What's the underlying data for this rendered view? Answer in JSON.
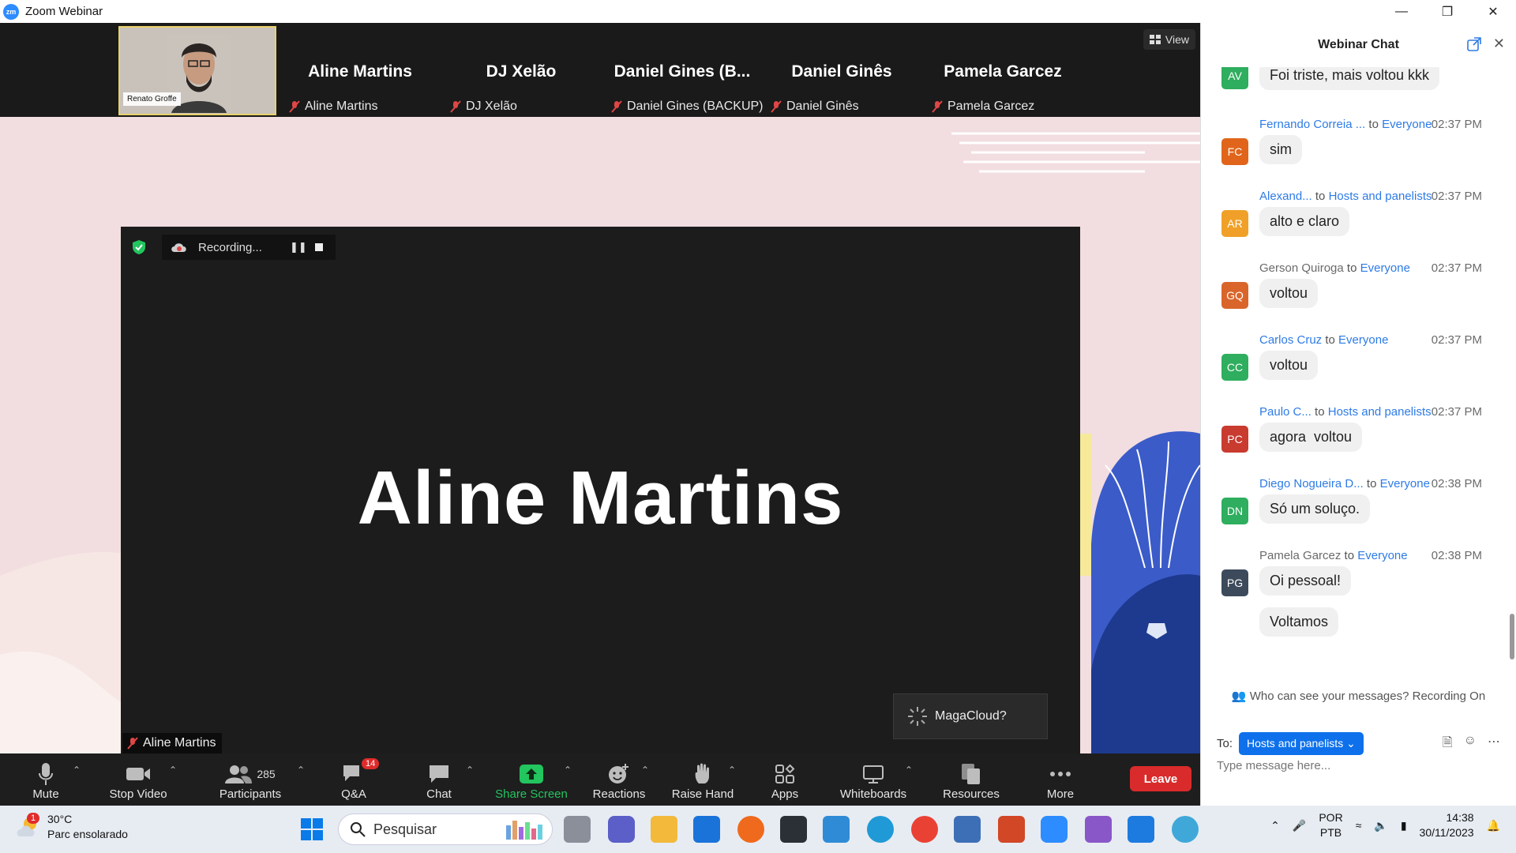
{
  "window": {
    "title": "Zoom Webinar",
    "app_icon": "zm"
  },
  "strip": {
    "self": {
      "name": "Renato Groffe"
    },
    "tiles": [
      {
        "big": "Aline Martins",
        "small": "Aline Martins"
      },
      {
        "big": "DJ Xelão",
        "small": "DJ Xelão"
      },
      {
        "big": "Daniel Gines (B...",
        "small": "Daniel Gines (BACKUP)"
      },
      {
        "big": "Daniel Ginês",
        "small": "Daniel Ginês"
      },
      {
        "big": "Pamela Garcez",
        "small": "Pamela Garcez"
      }
    ],
    "view_label": "View"
  },
  "stage": {
    "recording_label": "Recording...",
    "speaker_big": "Aline Martins",
    "speaker_label": "Aline Martins",
    "tooltip": "MagaCloud?"
  },
  "toolbar": {
    "mute": "Mute",
    "stop_video": "Stop Video",
    "participants": "Participants",
    "participants_count": "285",
    "qa": "Q&A",
    "qa_badge": "14",
    "chat": "Chat",
    "share": "Share Screen",
    "reactions": "Reactions",
    "raise_hand": "Raise Hand",
    "apps": "Apps",
    "whiteboards": "Whiteboards",
    "resources": "Resources",
    "more": "More",
    "leave": "Leave"
  },
  "chat": {
    "title": "Webinar Chat",
    "messages": [
      {
        "initials": "AV",
        "color": "#2eae5e",
        "sender": "",
        "to": "",
        "time": "",
        "text": "Foi triste, mais voltou kkk"
      },
      {
        "initials": "FC",
        "color": "#e0651b",
        "sender": "Fernando Correia ...",
        "to": "Everyone",
        "time": "02:37 PM",
        "text": "sim"
      },
      {
        "initials": "AR",
        "color": "#f0a028",
        "sender": "Alexand...",
        "to": "Hosts and panelists",
        "time": "02:37 PM",
        "text": "alto e claro"
      },
      {
        "initials": "GQ",
        "color": "#d9652a",
        "sender": "Gerson Quiroga",
        "to": "Everyone",
        "time": "02:37 PM",
        "text": "voltou"
      },
      {
        "initials": "CC",
        "color": "#2eae5e",
        "sender": "Carlos Cruz",
        "to": "Everyone",
        "time": "02:37 PM",
        "text": "voltou"
      },
      {
        "initials": "PC",
        "color": "#c93a2f",
        "sender": "Paulo C...",
        "to": "Hosts and panelists",
        "time": "02:37 PM",
        "text": "agora  voltou"
      },
      {
        "initials": "DN",
        "color": "#2eae5e",
        "sender": "Diego Nogueira D...",
        "to": "Everyone",
        "time": "02:38 PM",
        "text": "Só um soluço."
      },
      {
        "initials": "PG",
        "color": "#3d4a5c",
        "sender": "Pamela Garcez",
        "to": "Everyone",
        "time": "02:38 PM",
        "text": "Oi pessoal!",
        "text2": "Voltamos"
      }
    ],
    "to_word": "to",
    "who_can_see": "Who can see your messages? Recording On",
    "to_label": "To:",
    "to_value": "Hosts and panelists",
    "input_placeholder": "Type message here..."
  },
  "taskbar": {
    "temp": "30°C",
    "weather": "Parc ensolarado",
    "weather_badge": "1",
    "search": "Pesquisar",
    "lang1": "POR",
    "lang2": "PTB",
    "time": "14:38",
    "date": "30/11/2023"
  }
}
